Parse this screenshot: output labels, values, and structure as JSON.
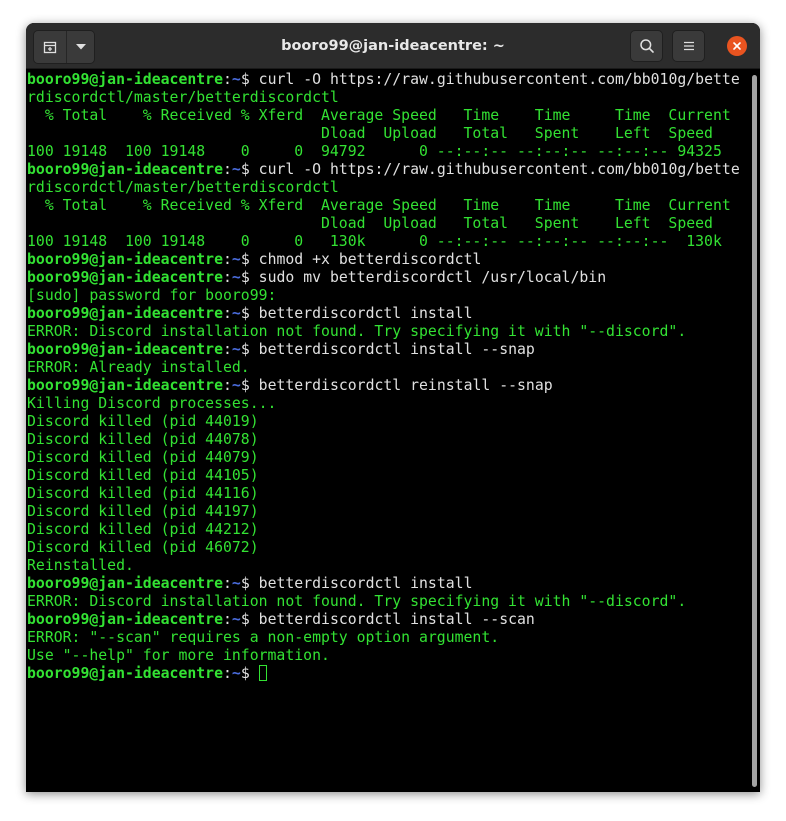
{
  "window": {
    "title": "booro99@jan-ideacentre: ~"
  },
  "colors": {
    "terminal_bg": "#000000",
    "prompt_green": "#33e233",
    "path_blue": "#4a6cdc",
    "close_orange": "#e95420",
    "titlebar": "#2c2c2c"
  },
  "icons": {
    "new_tab": "new-tab-icon",
    "dropdown": "chevron-down-icon",
    "search": "search-icon",
    "menu": "hamburger-menu-icon",
    "close": "close-icon"
  },
  "prompt": {
    "user": "booro99@jan-ideacentre",
    "sep": ":",
    "path": "~",
    "symbol": "$ "
  },
  "lines": [
    {
      "type": "prompt",
      "text": "curl -O https://raw.githubusercontent.com/bb010g/bette"
    },
    {
      "type": "out",
      "text": "rdiscordctl/master/betterdiscordctl"
    },
    {
      "type": "out",
      "text": "  % Total    % Received % Xferd  Average Speed   Time    Time     Time  Current"
    },
    {
      "type": "out",
      "text": "                                 Dload  Upload   Total   Spent    Left  Speed"
    },
    {
      "type": "out",
      "text": "100 19148  100 19148    0     0  94792      0 --:--:-- --:--:-- --:--:-- 94325"
    },
    {
      "type": "prompt",
      "text": "curl -O https://raw.githubusercontent.com/bb010g/bette"
    },
    {
      "type": "out",
      "text": "rdiscordctl/master/betterdiscordctl"
    },
    {
      "type": "out",
      "text": "  % Total    % Received % Xferd  Average Speed   Time    Time     Time  Current"
    },
    {
      "type": "out",
      "text": "                                 Dload  Upload   Total   Spent    Left  Speed"
    },
    {
      "type": "out",
      "text": "100 19148  100 19148    0     0   130k      0 --:--:-- --:--:-- --:--:--  130k"
    },
    {
      "type": "prompt",
      "text": "chmod +x betterdiscordctl"
    },
    {
      "type": "prompt",
      "text": "sudo mv betterdiscordctl /usr/local/bin"
    },
    {
      "type": "out",
      "text": "[sudo] password for booro99:"
    },
    {
      "type": "prompt",
      "text": "betterdiscordctl install"
    },
    {
      "type": "out",
      "text": "ERROR: Discord installation not found. Try specifying it with \"--discord\"."
    },
    {
      "type": "prompt",
      "text": "betterdiscordctl install --snap"
    },
    {
      "type": "out",
      "text": "ERROR: Already installed."
    },
    {
      "type": "prompt",
      "text": "betterdiscordctl reinstall --snap"
    },
    {
      "type": "out",
      "text": "Killing Discord processes..."
    },
    {
      "type": "out",
      "text": "Discord killed (pid 44019)"
    },
    {
      "type": "out",
      "text": "Discord killed (pid 44078)"
    },
    {
      "type": "out",
      "text": "Discord killed (pid 44079)"
    },
    {
      "type": "out",
      "text": "Discord killed (pid 44105)"
    },
    {
      "type": "out",
      "text": "Discord killed (pid 44116)"
    },
    {
      "type": "out",
      "text": "Discord killed (pid 44197)"
    },
    {
      "type": "out",
      "text": "Discord killed (pid 44212)"
    },
    {
      "type": "out",
      "text": "Discord killed (pid 46072)"
    },
    {
      "type": "out",
      "text": "Reinstalled."
    },
    {
      "type": "prompt",
      "text": "betterdiscordctl install"
    },
    {
      "type": "out",
      "text": "ERROR: Discord installation not found. Try specifying it with \"--discord\"."
    },
    {
      "type": "prompt",
      "text": "betterdiscordctl install --scan"
    },
    {
      "type": "out",
      "text": "ERROR: \"--scan\" requires a non-empty option argument."
    },
    {
      "type": "out",
      "text": "Use \"--help\" for more information."
    },
    {
      "type": "prompt",
      "text": "",
      "cursor": true
    }
  ]
}
